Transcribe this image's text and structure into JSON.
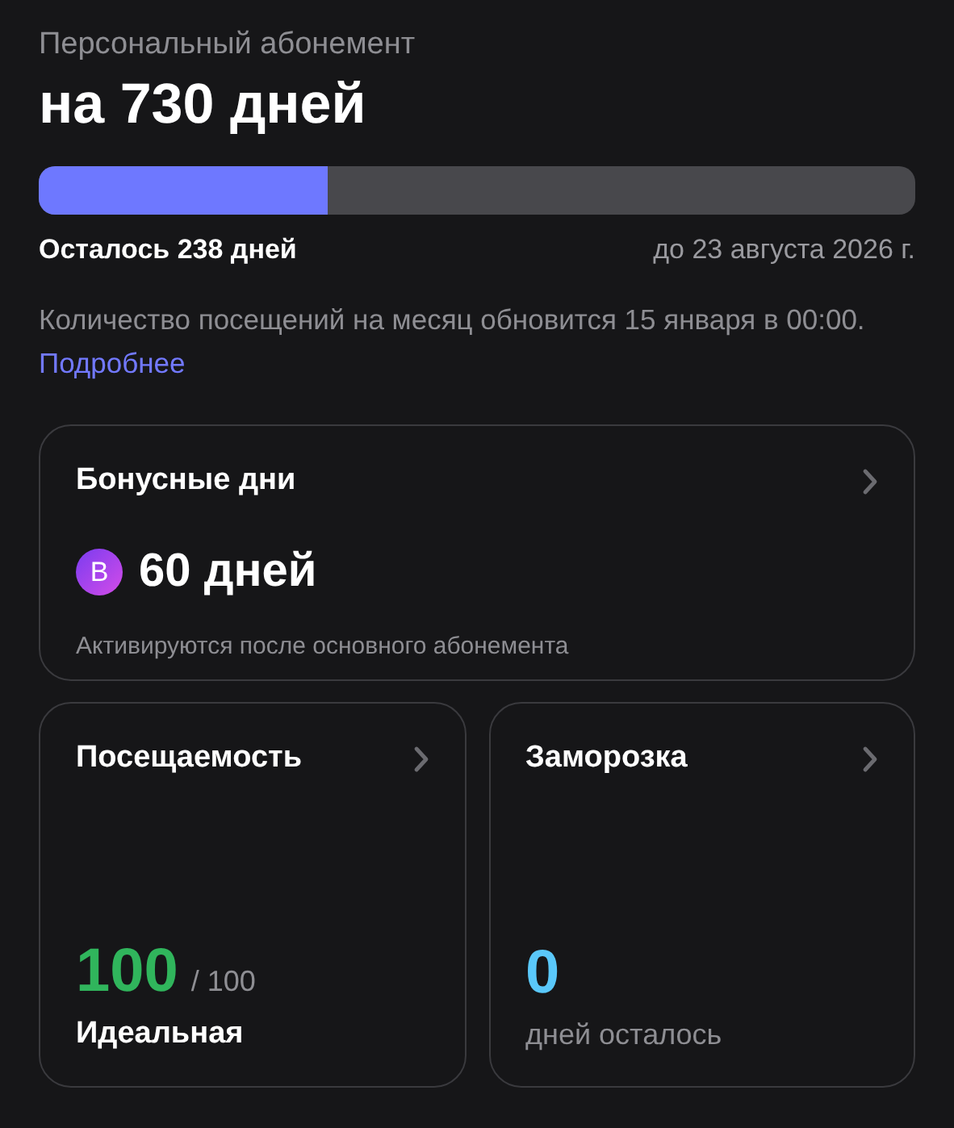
{
  "subscription": {
    "label": "Персональный абонемент",
    "title": "на 730 дней",
    "level": 0.33,
    "remaining": "Осталось 238 дней",
    "until": "до 23 августа 2026 г."
  },
  "notice": {
    "text": "Количество посещений на месяц обновится 15 января в 00:00.",
    "link": "Подробнее"
  },
  "bonus_card": {
    "title": "Бонусные дни",
    "badge": "B",
    "value": "60 дней",
    "caption": "Активируются после основного абонемента"
  },
  "stat_cards": [
    {
      "kind": "score",
      "title": "Посещаемость",
      "value": "100",
      "total": "/ 100",
      "caption": "Идеальная",
      "color": "#30b55c"
    },
    {
      "kind": "count",
      "title": "Заморозка",
      "value": "0",
      "caption": "дней осталось",
      "color": "#5ac8fa"
    }
  ]
}
